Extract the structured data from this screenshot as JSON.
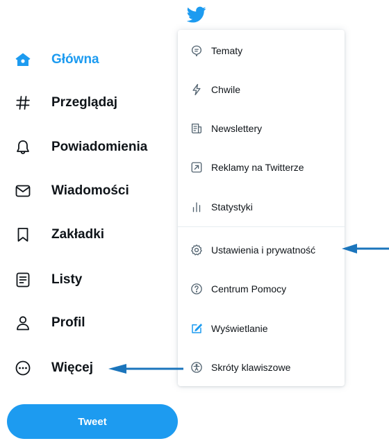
{
  "nav": {
    "items": [
      {
        "label": "Główna",
        "icon": "home-icon",
        "active": true
      },
      {
        "label": "Przeglądaj",
        "icon": "hashtag-icon"
      },
      {
        "label": "Powiadomienia",
        "icon": "bell-icon"
      },
      {
        "label": "Wiadomości",
        "icon": "envelope-icon"
      },
      {
        "label": "Zakładki",
        "icon": "bookmark-icon"
      },
      {
        "label": "Listy",
        "icon": "list-icon"
      },
      {
        "label": "Profil",
        "icon": "person-icon"
      },
      {
        "label": "Więcej",
        "icon": "more-circle-icon"
      }
    ],
    "tweet_label": "Tweet"
  },
  "menu": {
    "items": [
      {
        "label": "Tematy",
        "icon": "topics-icon"
      },
      {
        "label": "Chwile",
        "icon": "lightning-icon"
      },
      {
        "label": "Newslettery",
        "icon": "newsletter-icon"
      },
      {
        "label": "Reklamy na Twitterze",
        "icon": "external-arrow-icon"
      },
      {
        "label": "Statystyki",
        "icon": "analytics-icon"
      },
      {
        "label": "Ustawienia i prywatność",
        "icon": "gear-icon"
      },
      {
        "label": "Centrum Pomocy",
        "icon": "help-icon"
      },
      {
        "label": "Wyświetlanie",
        "icon": "display-icon"
      },
      {
        "label": "Skróty klawiszowe",
        "icon": "accessibility-icon"
      }
    ]
  },
  "colors": {
    "accent": "#1d9bf0",
    "annotation_arrow": "#1b75bc",
    "text": "#0f1419"
  }
}
